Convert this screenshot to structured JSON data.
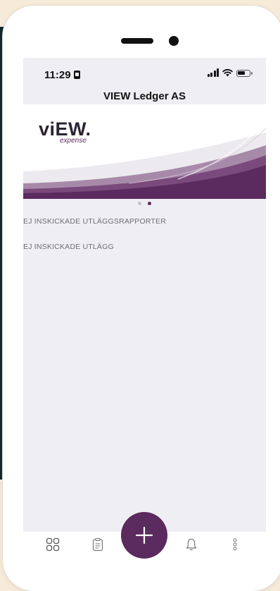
{
  "status_bar": {
    "time": "11:29"
  },
  "header": {
    "title": "VIEW Ledger AS"
  },
  "banner": {
    "logo_text": "viEW.",
    "logo_subtitle": "expense",
    "pager": {
      "count": 2,
      "active_index": 1
    }
  },
  "sections": [
    {
      "label": "EJ INSKICKADE UTLÄGGSRAPPORTER"
    },
    {
      "label": "EJ INSKICKADE UTLÄGG"
    }
  ],
  "tabbar": {
    "icons": [
      "dashboard-icon",
      "clipboard-icon",
      "add-icon",
      "bell-icon",
      "more-vertical-icon"
    ]
  },
  "colors": {
    "accent": "#5b2a5e",
    "background": "#efeef3",
    "page_background": "#f6ead9"
  }
}
